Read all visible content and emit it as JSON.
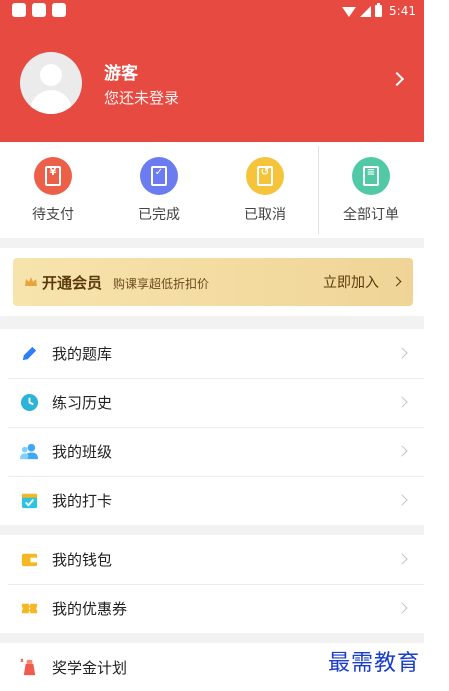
{
  "status_bar": {
    "time": "5:41"
  },
  "profile": {
    "name": "游客",
    "subtitle": "您还未登录"
  },
  "orders": [
    {
      "label": "待支付",
      "glyph": "¥",
      "color": "#ec5f48"
    },
    {
      "label": "已完成",
      "glyph": "✓",
      "color": "#6b7cf0"
    },
    {
      "label": "已取消",
      "glyph": "↺",
      "color": "#f6c43a"
    },
    {
      "label": "全部订单",
      "glyph": "≡",
      "color": "#52c9a6"
    }
  ],
  "vip": {
    "title": "开通会员",
    "subtitle": "购课享超低折扣价",
    "cta": "立即加入"
  },
  "menu_groups": [
    [
      {
        "label": "我的题库",
        "icon": "pencil-icon",
        "color": "#2d7ff9"
      },
      {
        "label": "练习历史",
        "icon": "clock-icon",
        "color": "#2bb3d9"
      },
      {
        "label": "我的班级",
        "icon": "users-icon",
        "color": "#3fa9f5"
      },
      {
        "label": "我的打卡",
        "icon": "calendar-check-icon",
        "color": "#2ec4e0"
      }
    ],
    [
      {
        "label": "我的钱包",
        "icon": "wallet-icon",
        "color": "#f5b822"
      },
      {
        "label": "我的优惠券",
        "icon": "coupon-icon",
        "color": "#f5b822"
      }
    ],
    [
      {
        "label": "奖学金计划",
        "icon": "scholarship-bag-icon",
        "color": "#ef5b4c"
      }
    ]
  ],
  "watermark": "最需教育"
}
